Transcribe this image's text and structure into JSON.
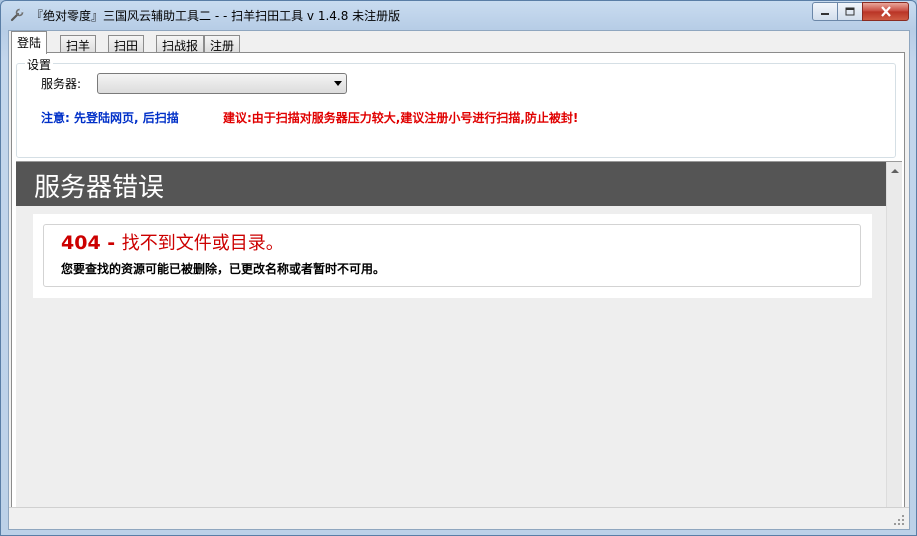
{
  "window": {
    "title": "『绝对零度』三国风云辅助工具二 - - 扫羊扫田工具 v 1.4.8   未注册版"
  },
  "tabs": [
    {
      "label": "登陆",
      "active": true
    },
    {
      "label": "扫羊"
    },
    {
      "label": "扫田"
    },
    {
      "label": "扫战报"
    },
    {
      "label": "注册"
    }
  ],
  "settings": {
    "legend": "设置",
    "server_label": "服务器:",
    "server_value": "",
    "notice_blue": "注意: 先登陆网页, 后扫描",
    "notice_red": "建议:由于扫描对服务器压力较大,建议注册小号进行扫描,防止被封!"
  },
  "web": {
    "header": "服务器错误",
    "error_code": "404 - ",
    "error_message": "找不到文件或目录。",
    "error_description": "您要查找的资源可能已被删除，已更改名称或者暂时不可用。"
  },
  "colors": {
    "notice_blue": "#0030c8",
    "notice_red": "#e00000",
    "error_red": "#cc0000",
    "header_bg": "#555555"
  }
}
